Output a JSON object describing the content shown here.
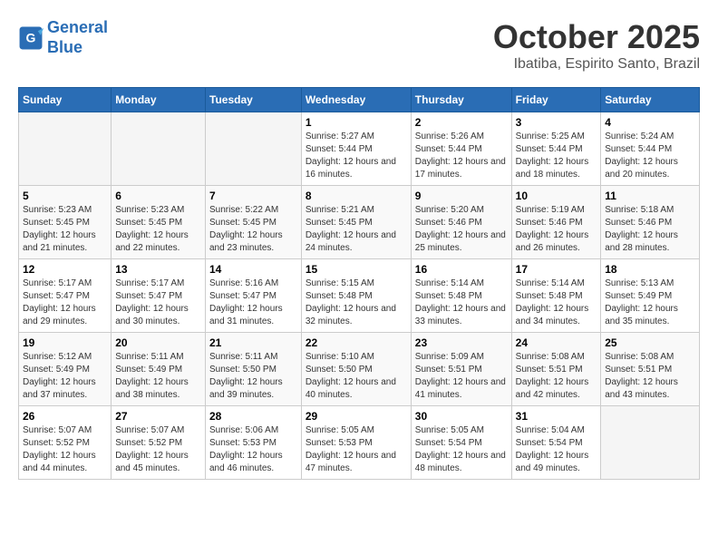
{
  "header": {
    "logo_line1": "General",
    "logo_line2": "Blue",
    "title": "October 2025",
    "subtitle": "Ibatiba, Espirito Santo, Brazil"
  },
  "weekdays": [
    "Sunday",
    "Monday",
    "Tuesday",
    "Wednesday",
    "Thursday",
    "Friday",
    "Saturday"
  ],
  "weeks": [
    [
      {
        "day": "",
        "info": ""
      },
      {
        "day": "",
        "info": ""
      },
      {
        "day": "",
        "info": ""
      },
      {
        "day": "1",
        "info": "Sunrise: 5:27 AM\nSunset: 5:44 PM\nDaylight: 12 hours\nand 16 minutes."
      },
      {
        "day": "2",
        "info": "Sunrise: 5:26 AM\nSunset: 5:44 PM\nDaylight: 12 hours\nand 17 minutes."
      },
      {
        "day": "3",
        "info": "Sunrise: 5:25 AM\nSunset: 5:44 PM\nDaylight: 12 hours\nand 18 minutes."
      },
      {
        "day": "4",
        "info": "Sunrise: 5:24 AM\nSunset: 5:44 PM\nDaylight: 12 hours\nand 20 minutes."
      }
    ],
    [
      {
        "day": "5",
        "info": "Sunrise: 5:23 AM\nSunset: 5:45 PM\nDaylight: 12 hours\nand 21 minutes."
      },
      {
        "day": "6",
        "info": "Sunrise: 5:23 AM\nSunset: 5:45 PM\nDaylight: 12 hours\nand 22 minutes."
      },
      {
        "day": "7",
        "info": "Sunrise: 5:22 AM\nSunset: 5:45 PM\nDaylight: 12 hours\nand 23 minutes."
      },
      {
        "day": "8",
        "info": "Sunrise: 5:21 AM\nSunset: 5:45 PM\nDaylight: 12 hours\nand 24 minutes."
      },
      {
        "day": "9",
        "info": "Sunrise: 5:20 AM\nSunset: 5:46 PM\nDaylight: 12 hours\nand 25 minutes."
      },
      {
        "day": "10",
        "info": "Sunrise: 5:19 AM\nSunset: 5:46 PM\nDaylight: 12 hours\nand 26 minutes."
      },
      {
        "day": "11",
        "info": "Sunrise: 5:18 AM\nSunset: 5:46 PM\nDaylight: 12 hours\nand 28 minutes."
      }
    ],
    [
      {
        "day": "12",
        "info": "Sunrise: 5:17 AM\nSunset: 5:47 PM\nDaylight: 12 hours\nand 29 minutes."
      },
      {
        "day": "13",
        "info": "Sunrise: 5:17 AM\nSunset: 5:47 PM\nDaylight: 12 hours\nand 30 minutes."
      },
      {
        "day": "14",
        "info": "Sunrise: 5:16 AM\nSunset: 5:47 PM\nDaylight: 12 hours\nand 31 minutes."
      },
      {
        "day": "15",
        "info": "Sunrise: 5:15 AM\nSunset: 5:48 PM\nDaylight: 12 hours\nand 32 minutes."
      },
      {
        "day": "16",
        "info": "Sunrise: 5:14 AM\nSunset: 5:48 PM\nDaylight: 12 hours\nand 33 minutes."
      },
      {
        "day": "17",
        "info": "Sunrise: 5:14 AM\nSunset: 5:48 PM\nDaylight: 12 hours\nand 34 minutes."
      },
      {
        "day": "18",
        "info": "Sunrise: 5:13 AM\nSunset: 5:49 PM\nDaylight: 12 hours\nand 35 minutes."
      }
    ],
    [
      {
        "day": "19",
        "info": "Sunrise: 5:12 AM\nSunset: 5:49 PM\nDaylight: 12 hours\nand 37 minutes."
      },
      {
        "day": "20",
        "info": "Sunrise: 5:11 AM\nSunset: 5:49 PM\nDaylight: 12 hours\nand 38 minutes."
      },
      {
        "day": "21",
        "info": "Sunrise: 5:11 AM\nSunset: 5:50 PM\nDaylight: 12 hours\nand 39 minutes."
      },
      {
        "day": "22",
        "info": "Sunrise: 5:10 AM\nSunset: 5:50 PM\nDaylight: 12 hours\nand 40 minutes."
      },
      {
        "day": "23",
        "info": "Sunrise: 5:09 AM\nSunset: 5:51 PM\nDaylight: 12 hours\nand 41 minutes."
      },
      {
        "day": "24",
        "info": "Sunrise: 5:08 AM\nSunset: 5:51 PM\nDaylight: 12 hours\nand 42 minutes."
      },
      {
        "day": "25",
        "info": "Sunrise: 5:08 AM\nSunset: 5:51 PM\nDaylight: 12 hours\nand 43 minutes."
      }
    ],
    [
      {
        "day": "26",
        "info": "Sunrise: 5:07 AM\nSunset: 5:52 PM\nDaylight: 12 hours\nand 44 minutes."
      },
      {
        "day": "27",
        "info": "Sunrise: 5:07 AM\nSunset: 5:52 PM\nDaylight: 12 hours\nand 45 minutes."
      },
      {
        "day": "28",
        "info": "Sunrise: 5:06 AM\nSunset: 5:53 PM\nDaylight: 12 hours\nand 46 minutes."
      },
      {
        "day": "29",
        "info": "Sunrise: 5:05 AM\nSunset: 5:53 PM\nDaylight: 12 hours\nand 47 minutes."
      },
      {
        "day": "30",
        "info": "Sunrise: 5:05 AM\nSunset: 5:54 PM\nDaylight: 12 hours\nand 48 minutes."
      },
      {
        "day": "31",
        "info": "Sunrise: 5:04 AM\nSunset: 5:54 PM\nDaylight: 12 hours\nand 49 minutes."
      },
      {
        "day": "",
        "info": ""
      }
    ]
  ]
}
